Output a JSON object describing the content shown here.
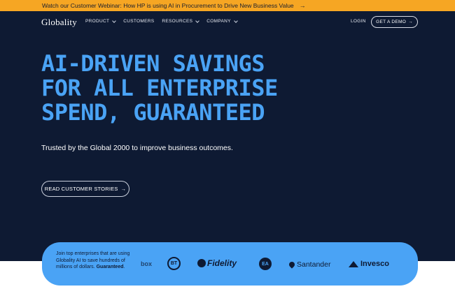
{
  "announcement": {
    "text": "Watch our Customer Webinar: How HP is using AI in Procurement to Drive New Business Value",
    "arrow": "→"
  },
  "nav": {
    "logo": "Globality",
    "items": [
      {
        "label": "PRODUCT",
        "dropdown": true
      },
      {
        "label": "CUSTOMERS",
        "dropdown": false
      },
      {
        "label": "RESOURCES",
        "dropdown": true
      },
      {
        "label": "COMPANY",
        "dropdown": true
      }
    ],
    "login": "LOGIN",
    "demo_button": "GET A DEMO",
    "demo_arrow": "→"
  },
  "hero": {
    "headline_lines": [
      "AI-DRIVEN SAVINGS",
      "FOR ALL ENTERPRISE",
      "SPEND, GUARANTEED"
    ],
    "subhead": "Trusted by the Global 2000 to improve business outcomes.",
    "cta": "READ CUSTOMER STORIES",
    "cta_arrow": "→"
  },
  "logos": {
    "blurb": "Join top enterprises that are using Globality AI to save hundreds of millions of dollars.",
    "blurb_bold": "Guaranteed",
    "blurb_end": ".",
    "brands": {
      "box": "box",
      "bt": "BT",
      "fidelity": "Fidelity",
      "ea": "EA",
      "santander": "Santander",
      "invesco": "Invesco"
    }
  },
  "colors": {
    "announcement_bg": "#f6a623",
    "hero_bg": "#0e1a33",
    "accent_blue": "#4aa3f5",
    "text_white": "#ffffff"
  }
}
